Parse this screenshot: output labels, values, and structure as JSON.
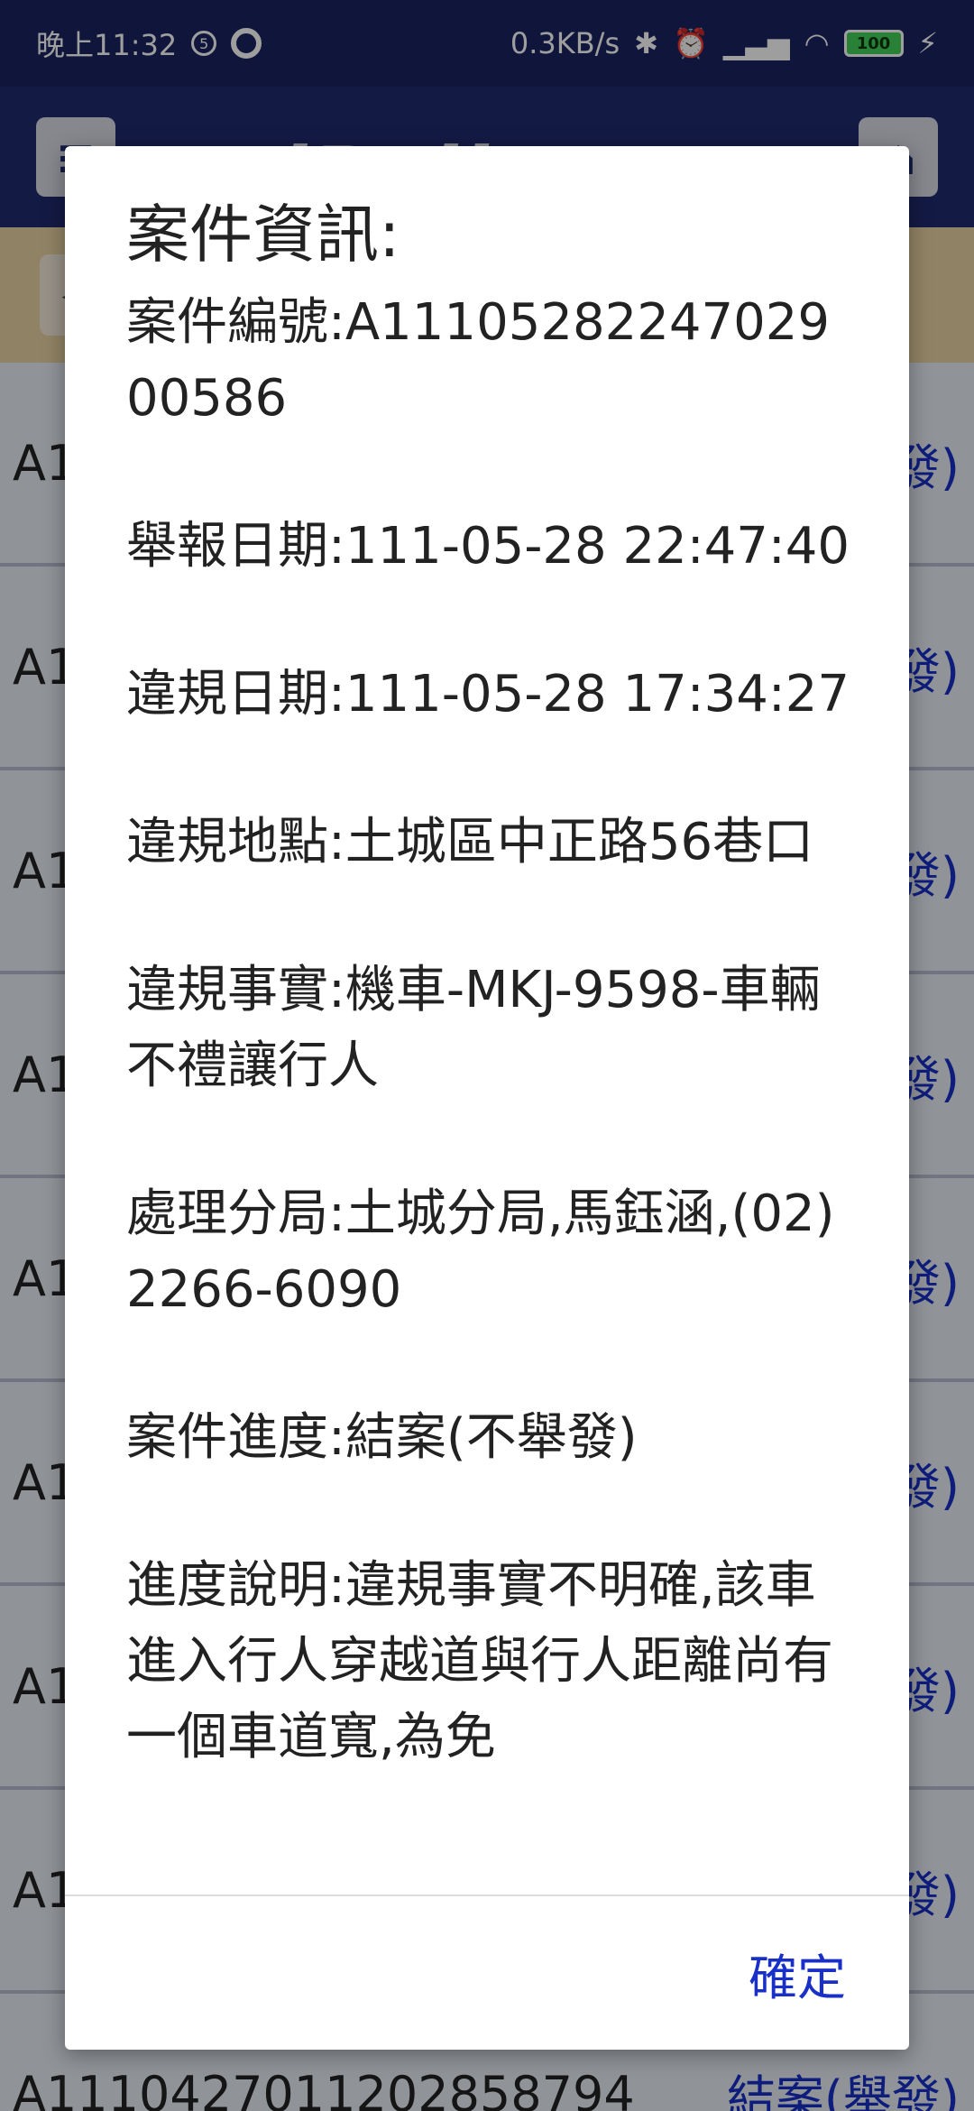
{
  "status_bar": {
    "time": "晚上11:32",
    "notification_count": "5",
    "speed": "0.3KB/s",
    "battery": "100",
    "bluetooth_icon": "✱",
    "alarm_icon": "⏰",
    "signal_icon": "▁▃▅",
    "wifi_icon": "◠",
    "charging_icon": "⚡"
  },
  "app": {
    "logo": "iPolice",
    "menu_icon": "≡",
    "home_icon": "⌂",
    "back_icon": "◀"
  },
  "case_list": [
    {
      "id": "A1",
      "status": "發)"
    },
    {
      "id": "A1",
      "status": "發)"
    },
    {
      "id": "A1",
      "status": "發)"
    },
    {
      "id": "A1",
      "status": "發)"
    },
    {
      "id": "A1",
      "status": "發)"
    },
    {
      "id": "A1",
      "status": "發)"
    },
    {
      "id": "A1",
      "status": "發)"
    },
    {
      "id": "A1",
      "status": "發)"
    },
    {
      "id": "A1110427011202858794",
      "status": "結案(舉發)"
    }
  ],
  "dialog": {
    "title": "案件資訊:",
    "fields": [
      "案件編號:A1110528224702900586",
      "舉報日期:111-05-28 22:47:40",
      "違規日期:111-05-28 17:34:27",
      "違規地點:土城區中正路56巷口",
      "違規事實:機車-MKJ-9598-車輛不禮讓行人",
      "處理分局:土城分局,馬鈺涵,(02)2266-6090",
      "案件進度:結案(不舉發)",
      "進度說明:違規事實不明確,該車進入行人穿越道與行人距離尚有一個車道寬,為免"
    ],
    "confirm_label": "確定"
  }
}
